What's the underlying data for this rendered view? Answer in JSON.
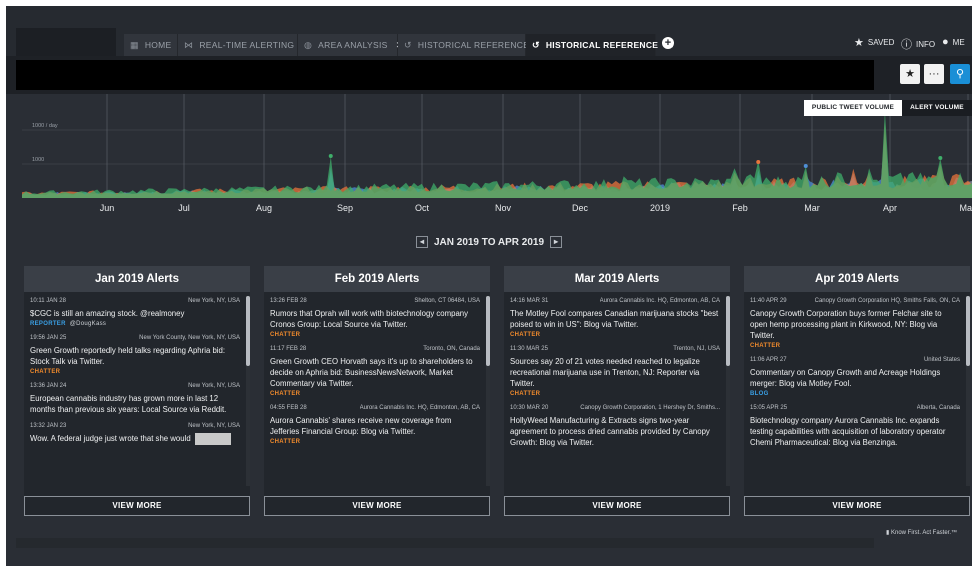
{
  "tabs": [
    {
      "label": "HOME",
      "icon": "grid-icon",
      "closable": false,
      "active": false
    },
    {
      "label": "REAL-TIME ALERTING",
      "icon": "pulse-icon",
      "closable": true,
      "active": false
    },
    {
      "label": "AREA ANALYSIS",
      "icon": "globe-icon",
      "closable": true,
      "active": false
    },
    {
      "label": "HISTORICAL REFERENCE",
      "icon": "history-icon",
      "closable": true,
      "active": false
    },
    {
      "label": "HISTORICAL REFERENCE",
      "icon": "history-icon",
      "closable": true,
      "active": true
    }
  ],
  "topnav": {
    "saved": "SAVED",
    "info": "INFO",
    "me": "ME"
  },
  "toolbar": {
    "star": "★",
    "more": "···",
    "search": "⚲"
  },
  "chart_data": {
    "type": "area",
    "toggles": [
      "PUBLIC TWEET VOLUME",
      "ALERT VOLUME"
    ],
    "active_toggle": "PUBLIC TWEET VOLUME",
    "y_tick_labels": [
      "1000 / day",
      "1000"
    ],
    "x_tick_labels": [
      "Jun",
      "Jul",
      "Aug",
      "Sep",
      "Oct",
      "Nov",
      "Dec",
      "2019",
      "Feb",
      "Mar",
      "Apr",
      "May"
    ],
    "series_colors": [
      "#3fae6a",
      "#e8743b",
      "#4f8fd6",
      "#8b93a0"
    ]
  },
  "range": {
    "label": "JAN 2019 TO APR 2019",
    "prev": "◂",
    "next": "▸"
  },
  "panels": [
    {
      "title": "Jan 2019 Alerts",
      "alerts": [
        {
          "time": "10:11 JAN 28",
          "location": "New York, NY, USA",
          "text": "$CGC is still an amazing stock. @realmoney",
          "tag": "REPORTER",
          "tag_class": "reporter",
          "handle": "@DougKass"
        },
        {
          "time": "19:56 JAN 25",
          "location": "New York County, New York, NY, USA",
          "text": "Green Growth reportedly held talks regarding Aphria bid: Stock Talk via Twitter.",
          "tag": "CHATTER",
          "tag_class": "chatter",
          "handle": ""
        },
        {
          "time": "13:36 JAN 24",
          "location": "New York, NY, USA",
          "text": "European cannabis industry has grown more in last 12 months than previous six years: Local Source via Reddit.",
          "tag": "",
          "tag_class": "",
          "handle": ""
        },
        {
          "time": "13:32 JAN 23",
          "location": "New York, NY, USA",
          "text": "Wow. A federal judge just wrote that she would",
          "tag": "",
          "tag_class": "",
          "handle": ""
        }
      ],
      "view_more": "VIEW MORE"
    },
    {
      "title": "Feb 2019 Alerts",
      "alerts": [
        {
          "time": "13:26 FEB 28",
          "location": "Shelton, CT 06484, USA",
          "text": "Rumors that Oprah will work with biotechnology company Cronos Group: Local Source via Twitter.",
          "tag": "CHATTER",
          "tag_class": "chatter",
          "handle": ""
        },
        {
          "time": "11:17 FEB 28",
          "location": "Toronto, ON, Canada",
          "text": "Green Growth CEO Horvath says it's up to shareholders to decide on Aphria bid: BusinessNewsNetwork, Market Commentary via Twitter.",
          "tag": "CHATTER",
          "tag_class": "chatter",
          "handle": ""
        },
        {
          "time": "04:55 FEB 28",
          "location": "Aurora Cannabis Inc. HQ, Edmonton, AB, CA",
          "text": "Aurora Cannabis' shares receive new coverage from Jefferies Financial Group: Blog via Twitter.",
          "tag": "CHATTER",
          "tag_class": "chatter",
          "handle": ""
        }
      ],
      "view_more": "VIEW MORE"
    },
    {
      "title": "Mar 2019 Alerts",
      "alerts": [
        {
          "time": "14:16 MAR 31",
          "location": "Aurora Cannabis Inc. HQ, Edmonton, AB, CA",
          "text": "The Motley Fool compares Canadian marijuana stocks \"best poised to win in US\": Blog via Twitter.",
          "tag": "CHATTER",
          "tag_class": "chatter",
          "handle": ""
        },
        {
          "time": "11:30 MAR 25",
          "location": "Trenton, NJ, USA",
          "text": "Sources say 20 of 21 votes needed reached to legalize recreational marijuana use in Trenton, NJ: Reporter via Twitter.",
          "tag": "CHATTER",
          "tag_class": "chatter",
          "handle": ""
        },
        {
          "time": "10:30 MAR 20",
          "location": "Canopy Growth Corporation, 1 Hershey Dr, Smiths...",
          "text": "HollyWeed Manufacturing & Extracts signs two-year agreement to process dried cannabis provided by Canopy Growth: Blog via Twitter.",
          "tag": "",
          "tag_class": "",
          "handle": ""
        }
      ],
      "view_more": "VIEW MORE"
    },
    {
      "title": "Apr 2019 Alerts",
      "alerts": [
        {
          "time": "11:40 APR 29",
          "location": "Canopy Growth Corporation HQ, Smiths Falls, ON, CA",
          "text": "Canopy Growth Corporation buys former Felchar site to open hemp processing plant in Kirkwood, NY: Blog via Twitter.",
          "tag": "CHATTER",
          "tag_class": "chatter",
          "handle": ""
        },
        {
          "time": "11:06 APR 27",
          "location": "United States",
          "text": "Commentary on Canopy Growth and Acreage Holdings merger: Blog via Motley Fool.",
          "tag": "BLOG",
          "tag_class": "blog",
          "handle": ""
        },
        {
          "time": "15:05 APR 25",
          "location": "Alberta, Canada",
          "text": "Biotechnology company Aurora Cannabis Inc. expands testing capabilities with acquisition of laboratory operator Chemi Pharmaceutical: Blog via Benzinga.",
          "tag": "",
          "tag_class": "",
          "handle": ""
        }
      ],
      "view_more": "VIEW MORE"
    }
  ],
  "footer": {
    "tagline": "Know First. Act Faster.™"
  }
}
